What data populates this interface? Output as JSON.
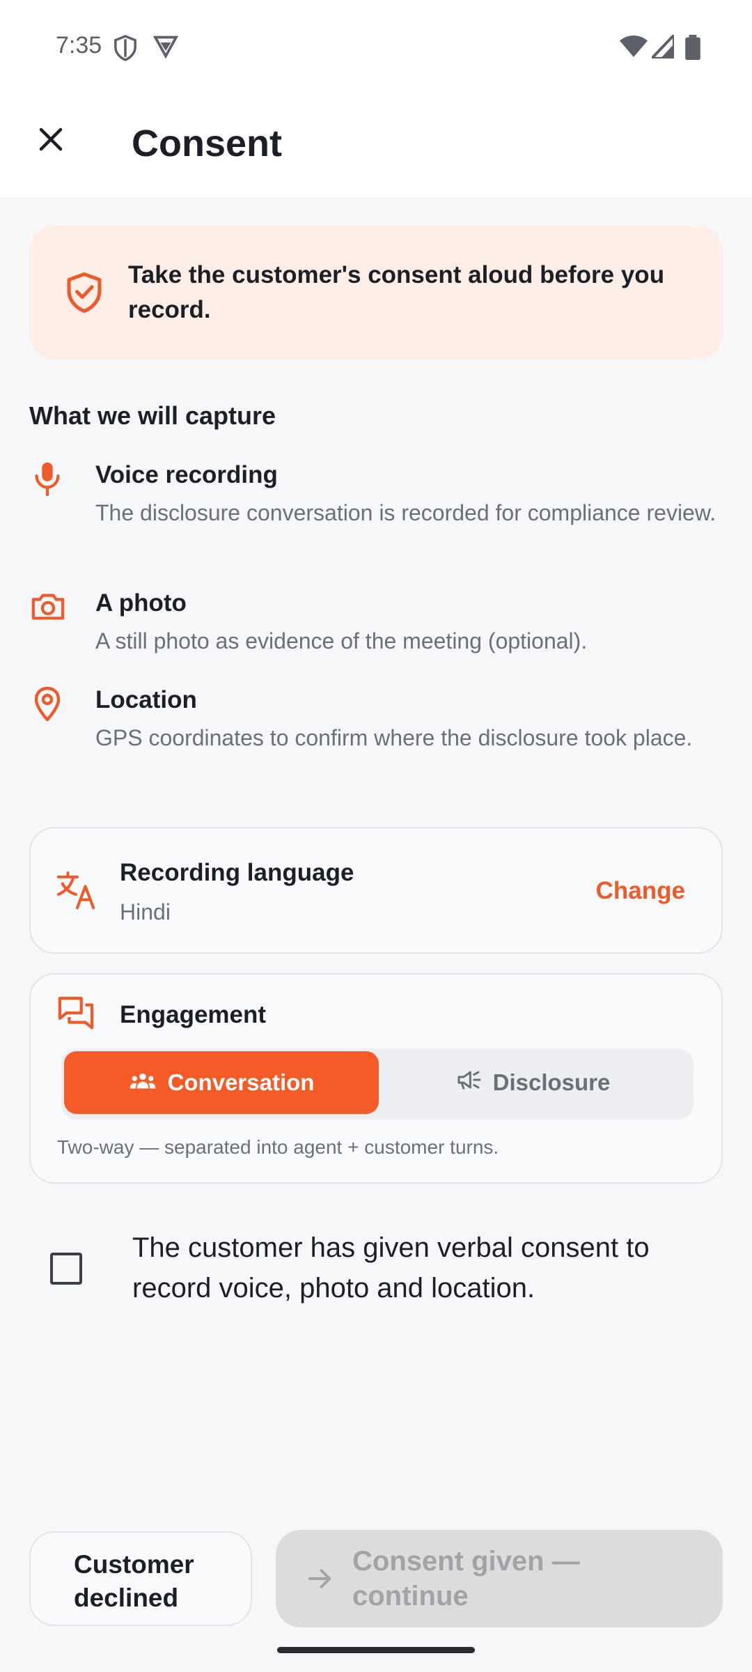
{
  "status_bar": {
    "time": "7:35",
    "icons": [
      "shield-status-icon",
      "vpn-status-icon",
      "wifi-icon",
      "signal-icon",
      "battery-icon"
    ]
  },
  "app_bar": {
    "title": "Consent",
    "close_icon": "close-icon"
  },
  "banner": {
    "icon": "shield-check-icon",
    "text": "Take the customer's consent aloud before you record."
  },
  "capture": {
    "title": "What we will capture",
    "items": [
      {
        "icon": "microphone-icon",
        "title": "Voice recording",
        "desc": "The disclosure conversation is recorded for compliance review."
      },
      {
        "icon": "camera-icon",
        "title": "A photo",
        "desc": "A still photo as evidence of the meeting (optional)."
      },
      {
        "icon": "location-pin-icon",
        "title": "Location",
        "desc": "GPS coordinates to confirm where the disclosure took place."
      }
    ]
  },
  "language": {
    "icon": "translate-icon",
    "title": "Recording language",
    "value": "Hindi",
    "change_label": "Change"
  },
  "engagement": {
    "icon": "chat-icon",
    "title": "Engagement",
    "options": [
      {
        "icon": "people-icon",
        "label": "Conversation",
        "selected": true
      },
      {
        "icon": "megaphone-icon",
        "label": "Disclosure",
        "selected": false
      }
    ],
    "note": "Two-way — separated into agent + customer turns."
  },
  "consent": {
    "checked": false,
    "text": "The customer has given verbal consent to record voice, photo and location."
  },
  "actions": {
    "declined_label": "Customer declined",
    "continue_label": "Consent given — continue",
    "continue_enabled": false
  },
  "colors": {
    "accent": "#f45b26",
    "banner_bg": "#fdeee7",
    "disabled_bg": "#dcdcdd"
  }
}
